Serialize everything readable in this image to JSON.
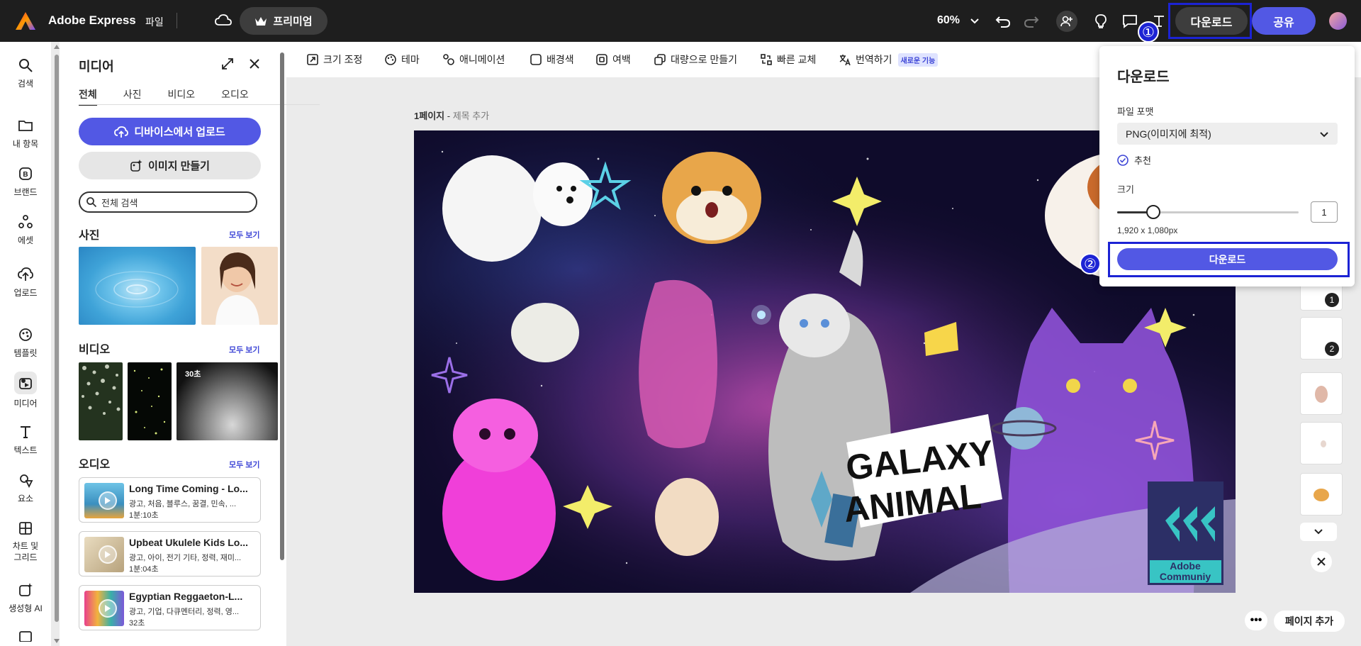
{
  "header": {
    "brand": "Adobe Express",
    "file_menu": "파일",
    "premium_label": "프리미엄",
    "zoom": "60%",
    "download_label": "다운로드",
    "share_label": "공유",
    "marker_1": "①",
    "marker_2": "②",
    "highlight_color": "#1c23d4",
    "accent_color": "#5258e4"
  },
  "rail": {
    "items": [
      {
        "label": "검색",
        "icon": "search-icon"
      },
      {
        "label": "내 항목",
        "icon": "folder-icon"
      },
      {
        "label": "브랜드",
        "icon": "brand-icon"
      },
      {
        "label": "에셋",
        "icon": "assets-icon"
      },
      {
        "label": "업로드",
        "icon": "upload-icon"
      },
      {
        "label": "템플릿",
        "icon": "template-icon"
      },
      {
        "label": "미디어",
        "icon": "media-icon"
      },
      {
        "label": "텍스트",
        "icon": "text-icon"
      },
      {
        "label": "요소",
        "icon": "elements-icon"
      },
      {
        "label": "차트 및 그리드",
        "icon": "chart-grid-icon"
      },
      {
        "label": "생성형 AI",
        "icon": "gen-ai-icon"
      }
    ]
  },
  "panel": {
    "title": "미디어",
    "tabs": [
      "전체",
      "사진",
      "비디오",
      "오디오"
    ],
    "upload_label": "디바이스에서 업로드",
    "generate_label": "이미지 만들기",
    "search_placeholder": "전체 검색",
    "photos_title": "사진",
    "videos_title": "비디오",
    "audio_title": "오디오",
    "see_all": "모두 보기",
    "video_duration": "30초",
    "audio": [
      {
        "title": "Long Time Coming - Lo...",
        "desc": "광고, 처음, 블루스, 꿈결, 민속, ...",
        "length": "1분:10초"
      },
      {
        "title": "Upbeat Ukulele Kids Lo...",
        "desc": "광고, 아이, 전기 기타, 정력, 재미...",
        "length": "1분:04초"
      },
      {
        "title": "Egyptian Reggaeton-L...",
        "desc": "광고, 기업, 다큐멘터리, 정력, 영...",
        "length": "32초"
      }
    ]
  },
  "toolbar": {
    "resize": "크기 조정",
    "theme": "테마",
    "animation": "애니메이션",
    "background": "배경색",
    "margin": "여백",
    "bulk": "대량으로 만들기",
    "quick_replace": "빠른 교체",
    "translate": "번역하기",
    "new_badge": "새로운 기능"
  },
  "canvas": {
    "page_label": "1페이지",
    "page_sep": " - ",
    "page_subtitle": "제목 추가",
    "title_line1": "GALAXY",
    "title_line2": "ANIMAL",
    "watermark_line1": "Adobe",
    "watermark_line2": "Communiy"
  },
  "download_popover": {
    "title": "다운로드",
    "format_label": "파일 포맷",
    "format_value": "PNG(이미지에 최적)",
    "recommended": "추천",
    "size_label": "크기",
    "size_value": "1",
    "size_fraction": 0.2,
    "dimensions": "1,920 x 1,080px",
    "download_button": "다운로드"
  },
  "pages": {
    "numbers": [
      "1",
      "2"
    ],
    "more": "•••",
    "add_page": "페이지 추가"
  }
}
